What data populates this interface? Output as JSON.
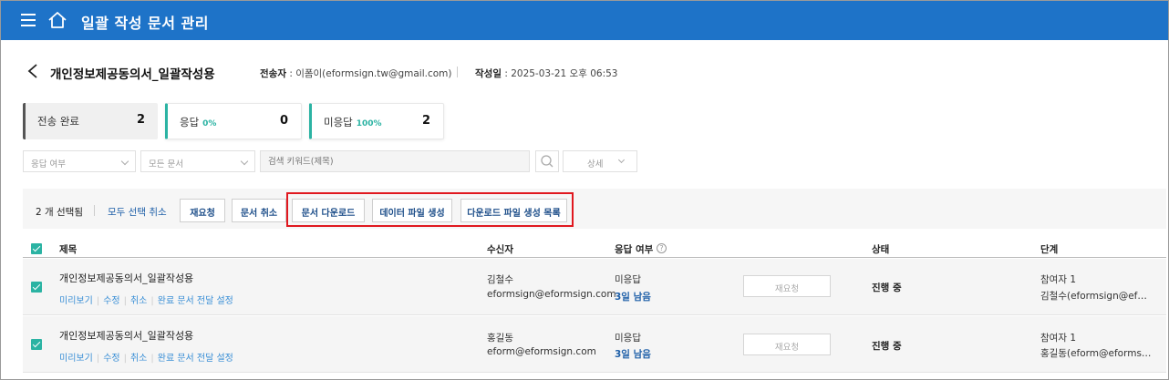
{
  "header": {
    "title": "일괄 작성 문서 관리"
  },
  "document": {
    "title": "개인정보제공동의서_일괄작성용",
    "sender_label": "전송자",
    "sender_value": "이폼이(eformsign.tw@gmail.com)",
    "created_label": "작성일",
    "created_value": "2025-03-21 오후 06:53"
  },
  "summary": {
    "total": {
      "label": "전송 완료",
      "count": "2"
    },
    "responded": {
      "label": "응답",
      "percent": "0%",
      "count": "0"
    },
    "not_responded": {
      "label": "미응답",
      "percent": "100%",
      "count": "2"
    }
  },
  "filters": {
    "response_select": "응답 여부",
    "doc_select": "모든 문서",
    "search_placeholder": "검색 키워드(제목)",
    "detail_label": "상세"
  },
  "actions": {
    "selected_count": "2 개 선택됨",
    "deselect_all": "모두 선택 취소",
    "re_request": "재요청",
    "cancel_doc": "문서 취소",
    "download_doc": "문서 다운로드",
    "create_data_file": "데이터 파일 생성",
    "download_file_list": "다운로드 파일 생성 목록"
  },
  "table": {
    "headers": {
      "title": "제목",
      "recipient": "수신자",
      "response": "응답 여부",
      "status": "상태",
      "step": "단계"
    },
    "rows": [
      {
        "title": "개인정보제공동의서_일괄작성용",
        "links": [
          "미리보기",
          "수정",
          "취소",
          "완료 문서 전달 설정"
        ],
        "recipient_name": "김철수",
        "recipient_email": "eformsign@eformsign.com",
        "response": "미응답",
        "due": "3일 남음",
        "reask": "재요청",
        "status": "진행 중",
        "step_label": "참여자 1",
        "step_name": "김철수(eformsign@ef…"
      },
      {
        "title": "개인정보제공동의서_일괄작성용",
        "links": [
          "미리보기",
          "수정",
          "취소",
          "완료 문서 전달 설정"
        ],
        "recipient_name": "홍길동",
        "recipient_email": "eform@eformsign.com",
        "response": "미응답",
        "due": "3일 남음",
        "reask": "재요청",
        "status": "진행 중",
        "step_label": "참여자 1",
        "step_name": "홍길동(eform@eforms…"
      }
    ]
  },
  "colors": {
    "header_bg": "#1e73c8",
    "accent": "#2bb3a3",
    "link": "#3a8fd6",
    "highlight": "#e0181f"
  }
}
